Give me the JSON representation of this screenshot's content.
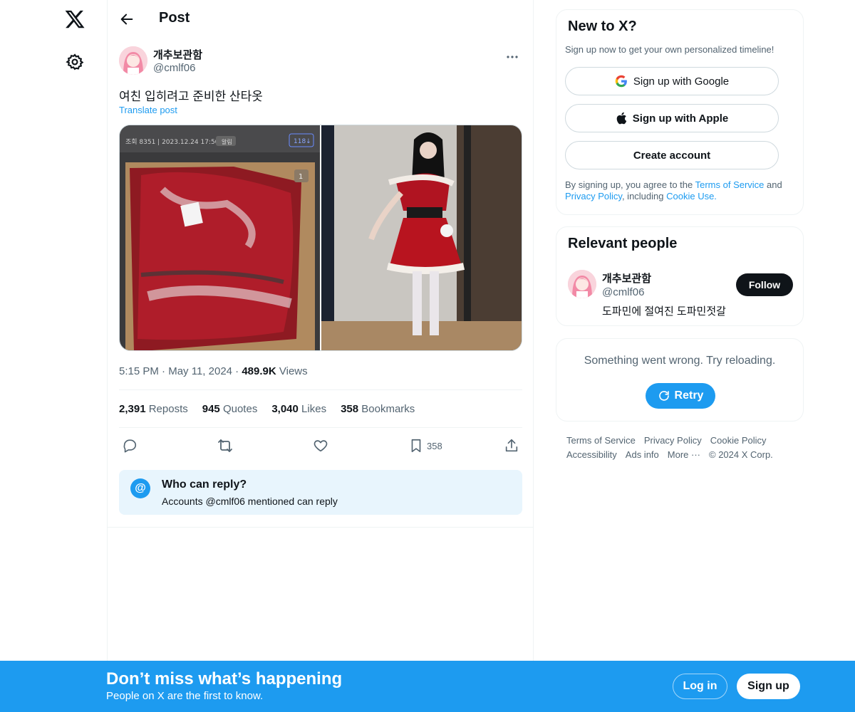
{
  "header": {
    "title": "Post"
  },
  "post": {
    "author_name": "개추보관함",
    "author_handle": "@cmlf06",
    "text": "여친 입히려고 준비한 산타옷",
    "translate_label": "Translate post",
    "time": "5:15 PM",
    "date": "May 11, 2024",
    "views_count": "489.9K",
    "views_label": "Views",
    "overlay": {
      "views_line": "조회 8351 | 2023.12.24 17:50",
      "notify": "알림",
      "badge": "118↓",
      "page_number": "1"
    }
  },
  "stats": {
    "reposts_count": "2,391",
    "reposts_label": "Reposts",
    "quotes_count": "945",
    "quotes_label": "Quotes",
    "likes_count": "3,040",
    "likes_label": "Likes",
    "bookmarks_count": "358",
    "bookmarks_label": "Bookmarks"
  },
  "actions": {
    "bookmark_count": "358"
  },
  "who_can_reply": {
    "icon": "@",
    "title": "Who can reply?",
    "subtitle": "Accounts @cmlf06 mentioned can reply"
  },
  "signup_card": {
    "title": "New to X?",
    "subtitle": "Sign up now to get your own personalized timeline!",
    "google_label": "Sign up with Google",
    "apple_label": "Sign up with Apple",
    "create_label": "Create account",
    "legal_pre": "By signing up, you agree to the ",
    "terms_link": "Terms of Service",
    "legal_and": " and ",
    "privacy_link": "Privacy Policy",
    "legal_including": ", including ",
    "cookie_link": "Cookie Use."
  },
  "relevant_people": {
    "title": "Relevant people",
    "name": "개추보관함",
    "handle": "@cmlf06",
    "bio": "도파민에 절여진 도파민젓갈",
    "follow_label": "Follow"
  },
  "trends_error": {
    "message": "Something went wrong. Try reloading.",
    "retry_label": "Retry"
  },
  "footer": {
    "terms": "Terms of Service",
    "privacy": "Privacy Policy",
    "cookie": "Cookie Policy",
    "accessibility": "Accessibility",
    "ads": "Ads info",
    "more": "More ···",
    "copyright": "© 2024 X Corp."
  },
  "banner": {
    "title": "Don’t miss what’s happening",
    "subtitle": "People on X are the first to know.",
    "login_label": "Log in",
    "signup_label": "Sign up"
  },
  "colors": {
    "accent": "#1d9bf0",
    "text": "#0f1419",
    "muted": "#536471",
    "border": "#eff3f4"
  }
}
